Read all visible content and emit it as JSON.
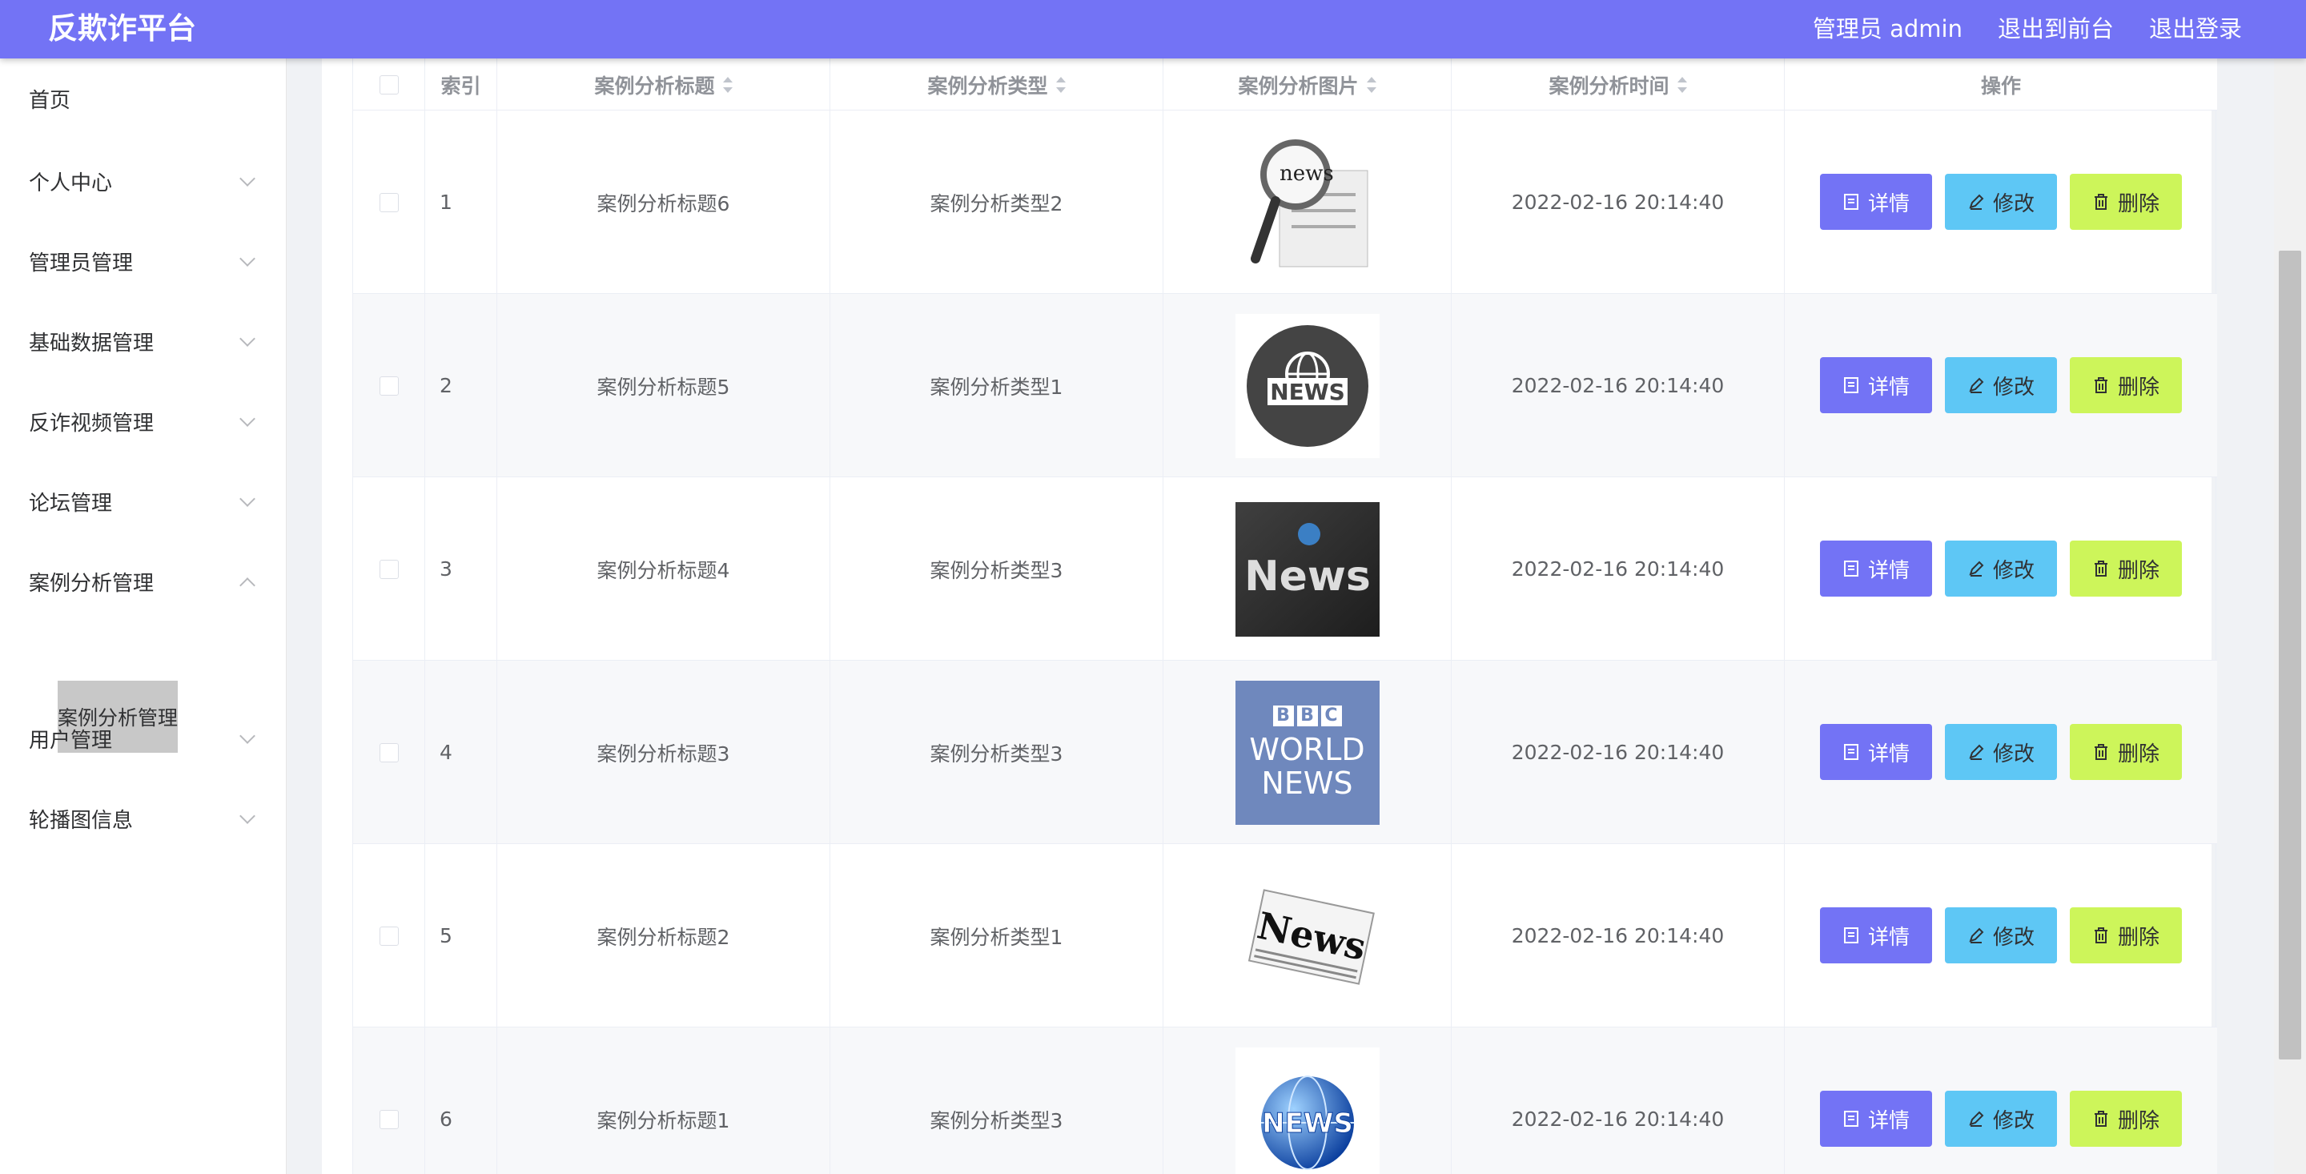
{
  "header": {
    "title": "反欺诈平台",
    "links": [
      "管理员 admin",
      "退出到前台",
      "退出登录"
    ]
  },
  "sidebar": {
    "items": [
      {
        "label": "首页"
      },
      {
        "label": "个人中心"
      },
      {
        "label": "管理员管理"
      },
      {
        "label": "基础数据管理"
      },
      {
        "label": "反诈视频管理"
      },
      {
        "label": "论坛管理"
      },
      {
        "label": "案例分析管理",
        "expanded": true
      },
      {
        "label": "用户管理"
      },
      {
        "label": "轮播图信息"
      }
    ],
    "submenu_label": "案例分析管理"
  },
  "table": {
    "columns": [
      "索引",
      "案例分析标题",
      "案例分析类型",
      "案例分析图片",
      "案例分析时间",
      "操作"
    ],
    "rows": [
      {
        "index": "1",
        "title": "案例分析标题6",
        "type": "案例分析类型2",
        "image": "news-magnifier-icon",
        "time": "2022-02-16 20:14:40"
      },
      {
        "index": "2",
        "title": "案例分析标题5",
        "type": "案例分析类型1",
        "image": "news-globe-badge-icon",
        "time": "2022-02-16 20:14:40"
      },
      {
        "index": "3",
        "title": "案例分析标题4",
        "type": "案例分析类型3",
        "image": "news-dark-poster-icon",
        "time": "2022-02-16 20:14:40"
      },
      {
        "index": "4",
        "title": "案例分析标题3",
        "type": "案例分析类型3",
        "image": "bbc-world-news-logo",
        "time": "2022-02-16 20:14:40"
      },
      {
        "index": "5",
        "title": "案例分析标题2",
        "type": "案例分析类型1",
        "image": "newspaper-icon",
        "time": "2022-02-16 20:14:40"
      },
      {
        "index": "6",
        "title": "案例分析标题1",
        "type": "案例分析类型3",
        "image": "news-globe-3d-icon",
        "time": "2022-02-16 20:14:40"
      }
    ],
    "actions": {
      "detail": "详情",
      "edit": "修改",
      "delete": "删除"
    },
    "bbc_logo": {
      "letters": [
        "B",
        "B",
        "C"
      ],
      "line1": "WORLD",
      "line2": "NEWS"
    },
    "image_text": {
      "news": "news",
      "NEWS": "NEWS",
      "News": "News"
    }
  },
  "colors": {
    "header": "#7373f5",
    "detail_button": "#7373f5",
    "edit_button": "#5ec7f5",
    "delete_button": "#cdf55a",
    "bbc_background": "#6f88bd"
  }
}
